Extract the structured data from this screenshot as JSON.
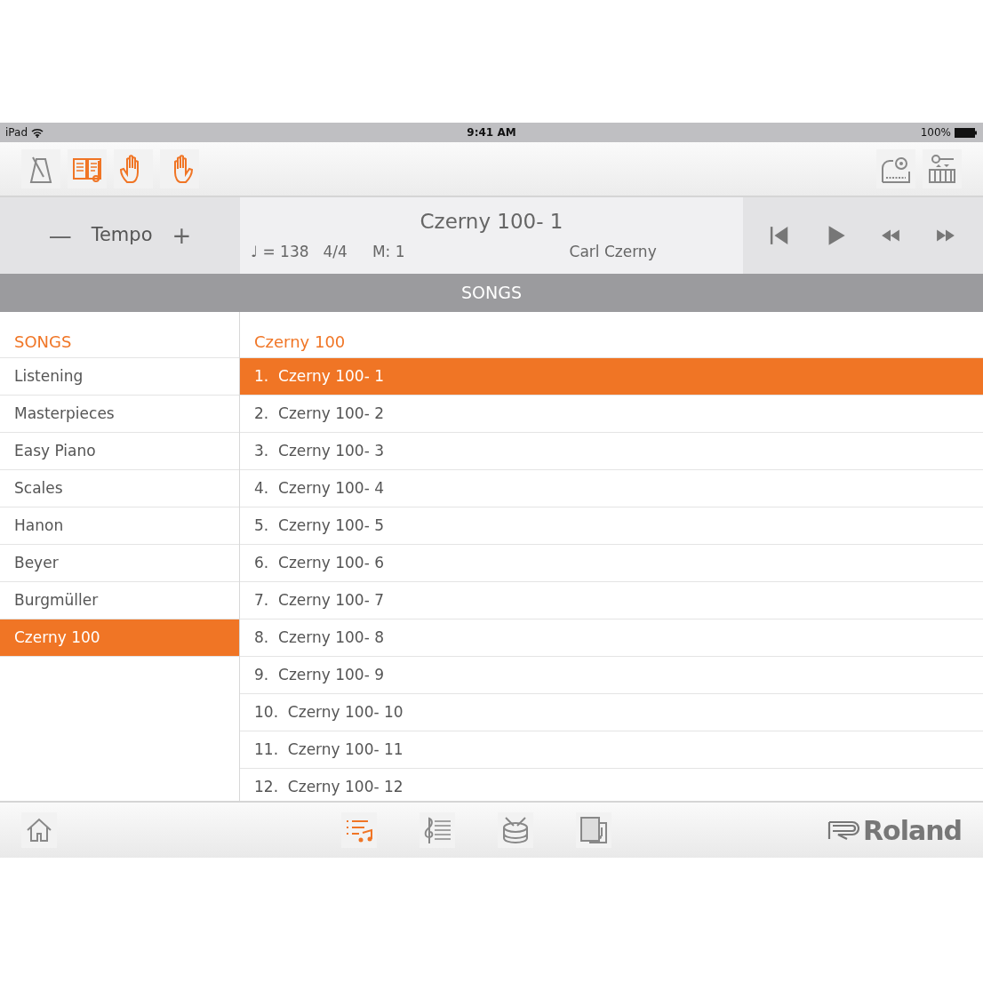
{
  "status_bar": {
    "device": "iPad",
    "time": "9:41 AM",
    "battery": "100%"
  },
  "toolbar": {
    "left": [
      {
        "kind": "metronome",
        "on": false
      },
      {
        "kind": "score",
        "on": true
      },
      {
        "kind": "left-hand",
        "on": true
      },
      {
        "kind": "right-hand",
        "on": true
      }
    ],
    "right": [
      {
        "kind": "piano-settings"
      },
      {
        "kind": "instrument-keyboard"
      }
    ]
  },
  "tempo": {
    "minus": "—",
    "label": "Tempo",
    "plus": "+"
  },
  "now_playing": {
    "title": "Czerny 100- 1",
    "tempo": "♩ = 138",
    "meter": "4/4",
    "measure": "M: 1",
    "composer": "Carl Czerny"
  },
  "transport": [
    {
      "kind": "skip-back"
    },
    {
      "kind": "play"
    },
    {
      "kind": "rewind"
    },
    {
      "kind": "fast-forward"
    }
  ],
  "section_title": "SONGS",
  "categories": {
    "header": "SONGS",
    "items": [
      {
        "label": "Listening",
        "selected": false
      },
      {
        "label": "Masterpieces",
        "selected": false
      },
      {
        "label": "Easy Piano",
        "selected": false
      },
      {
        "label": "Scales",
        "selected": false
      },
      {
        "label": "Hanon",
        "selected": false
      },
      {
        "label": "Beyer",
        "selected": false
      },
      {
        "label": "Burgmüller",
        "selected": false
      },
      {
        "label": "Czerny 100",
        "selected": true
      }
    ]
  },
  "songs": {
    "header": "Czerny 100",
    "items": [
      {
        "number": "1.",
        "title": "Czerny 100- 1",
        "selected": true
      },
      {
        "number": "2.",
        "title": "Czerny 100- 2",
        "selected": false
      },
      {
        "number": "3.",
        "title": "Czerny 100- 3",
        "selected": false
      },
      {
        "number": "4.",
        "title": "Czerny 100- 4",
        "selected": false
      },
      {
        "number": "5.",
        "title": "Czerny 100- 5",
        "selected": false
      },
      {
        "number": "6.",
        "title": "Czerny 100- 6",
        "selected": false
      },
      {
        "number": "7.",
        "title": "Czerny 100- 7",
        "selected": false
      },
      {
        "number": "8.",
        "title": "Czerny 100- 8",
        "selected": false
      },
      {
        "number": "9.",
        "title": "Czerny 100- 9",
        "selected": false
      },
      {
        "number": "10.",
        "title": "Czerny 100- 10",
        "selected": false
      },
      {
        "number": "11.",
        "title": "Czerny 100- 11",
        "selected": false
      },
      {
        "number": "12.",
        "title": "Czerny 100- 12",
        "selected": false
      }
    ]
  },
  "bottom_bar": {
    "tabs": [
      {
        "kind": "home",
        "selected": false
      },
      {
        "kind": "song-list",
        "selected": true
      },
      {
        "kind": "score",
        "selected": false
      },
      {
        "kind": "rhythm",
        "selected": false
      },
      {
        "kind": "flash-card",
        "selected": false
      }
    ],
    "brand": "Roland"
  }
}
